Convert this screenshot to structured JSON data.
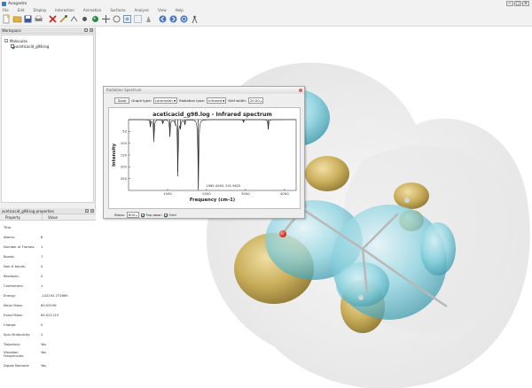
{
  "window": {
    "title": "Avogadro"
  },
  "menu": [
    "File",
    "Edit",
    "Display",
    "Interaction",
    "Animation",
    "Surfaces",
    "Analysis",
    "View",
    "Help"
  ],
  "toolbar": {
    "icons": [
      "new-file-icon",
      "open-file-icon",
      "save-icon",
      "close-icon",
      "build-icon",
      "measure-icon",
      "dot-icon",
      "color-icon",
      "move-icon",
      "rotate-icon",
      "zoom-icon",
      "select-icon",
      "navigate-icon",
      "back-icon",
      "forward-icon",
      "refresh-icon",
      "user-icon"
    ]
  },
  "workspace": {
    "title": "Workspace",
    "tree": {
      "root": "Molecules",
      "child": "aceticacid_g98.log"
    }
  },
  "properties": {
    "title": "aceticacid_g98.log properties",
    "col_property": "Property",
    "col_value": "Value",
    "rows": [
      {
        "label": "Title:",
        "value": ""
      },
      {
        "label": "Atoms:",
        "value": "8"
      },
      {
        "label": "Number of Frames:",
        "value": "1"
      },
      {
        "label": "Bonds:",
        "value": "7"
      },
      {
        "label": "Non-H bonds:",
        "value": "4"
      },
      {
        "label": "Residues:",
        "value": "0"
      },
      {
        "label": "Conformers:",
        "value": "1"
      },
      {
        "label": "Energy:",
        "value": "-142192.272665"
      },
      {
        "label": "Molar Mass:",
        "value": "60.05196"
      },
      {
        "label": "Exact Mass:",
        "value": "60.021129"
      },
      {
        "label": "Charge:",
        "value": "0"
      },
      {
        "label": "Spin Multiplicity:",
        "value": "1"
      },
      {
        "label": "Trajectory:",
        "value": "Yes"
      },
      {
        "label": "Vibration Frequencies:",
        "value": "Yes"
      },
      {
        "label": "Dipole Moment:",
        "value": "Yes"
      }
    ]
  },
  "spectrum": {
    "window_title": "Radiation Spectrum",
    "save_label": "Save",
    "graph_type_label": "Graph type:",
    "graph_type_value": "Lorentzian",
    "radiation_type_label": "Radiation type:",
    "radiation_type_value": "Infrared",
    "half_width_label": "Half width:",
    "half_width_value": "20.00",
    "steps_label": "Steps:",
    "steps_value": "600",
    "topdown_label": "Top-down",
    "grid_label": "Grid",
    "readout": "1965.4260, 291.9620"
  },
  "chart_data": {
    "type": "line",
    "title": "aceticacid_g98.log - Infrared spectrum",
    "xlabel": "Frequency (cm-1)",
    "ylabel": "Intensity",
    "xlim": [
      0,
      4300
    ],
    "ylim": [
      0,
      300
    ],
    "y_inverted": true,
    "x_ticks": [
      1000,
      2000,
      3000,
      4000
    ],
    "y_ticks": [
      50,
      100,
      150,
      200,
      250
    ],
    "grid": false,
    "peaks": [
      {
        "x": 560,
        "y": 30
      },
      {
        "x": 650,
        "y": 95
      },
      {
        "x": 880,
        "y": 18
      },
      {
        "x": 1060,
        "y": 72
      },
      {
        "x": 1200,
        "y": 15
      },
      {
        "x": 1265,
        "y": 240
      },
      {
        "x": 1330,
        "y": 35
      },
      {
        "x": 1445,
        "y": 22
      },
      {
        "x": 1790,
        "y": 298
      },
      {
        "x": 2950,
        "y": 12
      },
      {
        "x": 3585,
        "y": 42
      }
    ]
  },
  "colors": {
    "isosurface_positive": "#6fc4d4",
    "isosurface_negative": "#b59a32",
    "oxygen": "#d9281e",
    "bond": "#b8b8b8"
  }
}
